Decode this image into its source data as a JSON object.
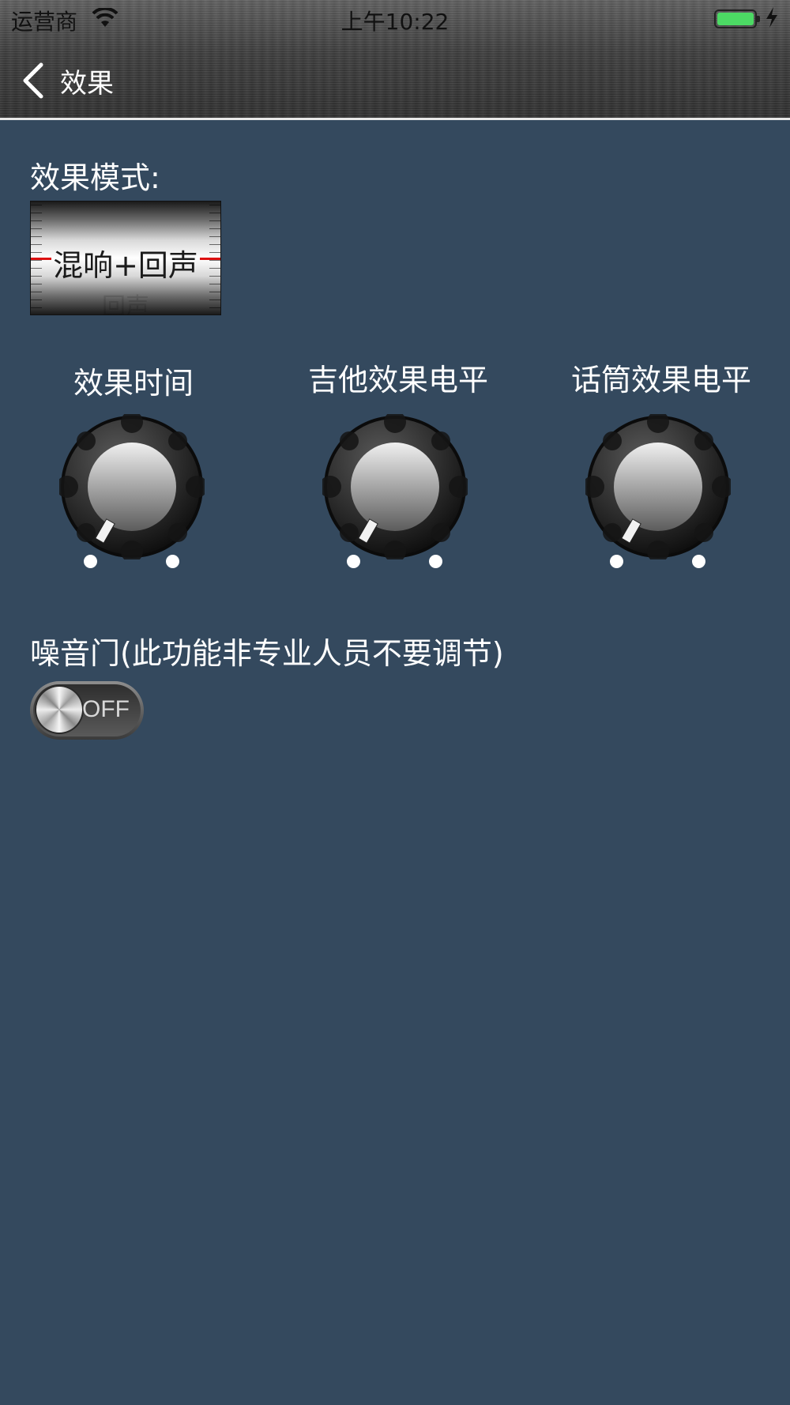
{
  "status_bar": {
    "carrier": "运营商",
    "time": "上午10:22"
  },
  "nav": {
    "title": "效果"
  },
  "effect_mode": {
    "label": "效果模式:",
    "value": "混响+回声",
    "next_value_hint": "回声"
  },
  "knobs": [
    {
      "label": "效果时间"
    },
    {
      "label": "吉他效果电平"
    },
    {
      "label": "话筒效果电平"
    }
  ],
  "noise_gate": {
    "label": "噪音门(此功能非专业人员不要调节)",
    "state": "OFF"
  },
  "colors": {
    "background": "#34495e",
    "battery": "#4cd964",
    "drum_marker": "#d11111"
  }
}
